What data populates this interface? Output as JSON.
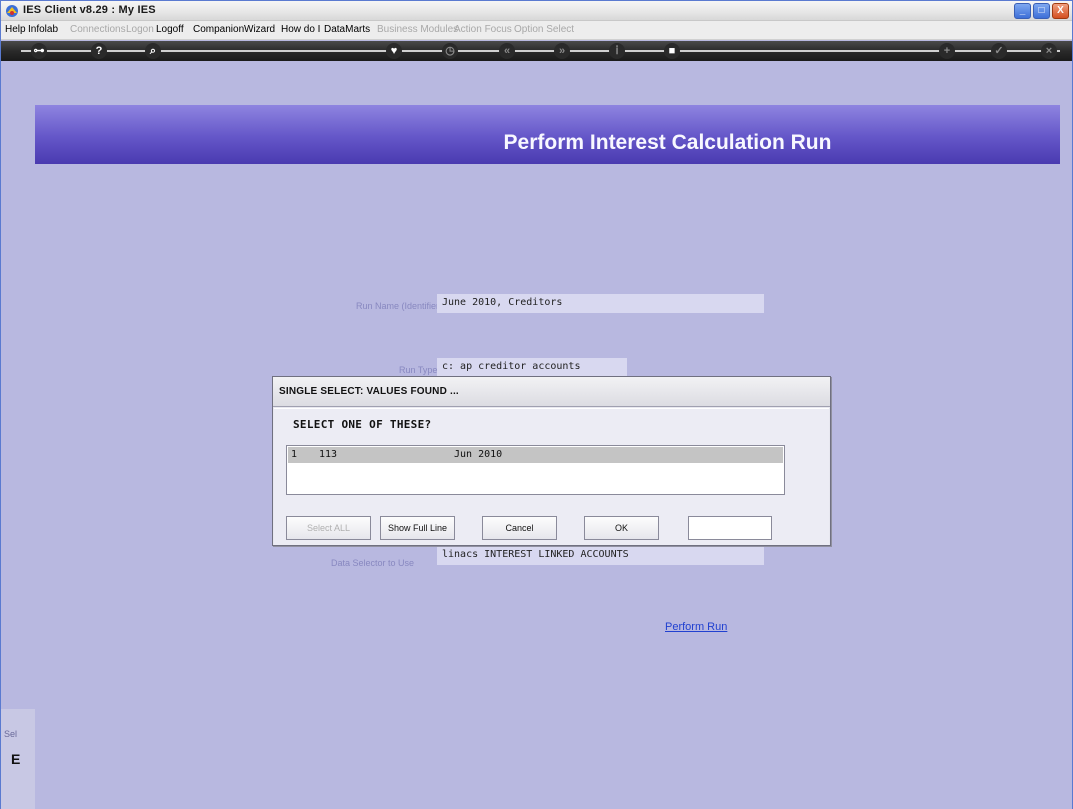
{
  "window": {
    "title": "IES Client v8.29 : My IES",
    "controls": {
      "minimize": "_",
      "maximize": "□",
      "close": "X"
    }
  },
  "menu": {
    "items": [
      {
        "label": "Help",
        "enabled": true
      },
      {
        "label": "Infolab",
        "enabled": true
      },
      {
        "label": "Connections",
        "enabled": false
      },
      {
        "label": "Logon",
        "enabled": false
      },
      {
        "label": "Logoff",
        "enabled": true
      },
      {
        "label": "Companion",
        "enabled": true
      },
      {
        "label": "Wizard",
        "enabled": true
      },
      {
        "label": "How do I",
        "enabled": true
      },
      {
        "label": "DataMarts",
        "enabled": true
      },
      {
        "label": "Business Modules",
        "enabled": false
      },
      {
        "label": "Action Focus",
        "enabled": false
      },
      {
        "label": "Option Select",
        "enabled": false
      }
    ]
  },
  "toolbar": {
    "icons": [
      {
        "name": "key-icon",
        "glyph": "⊶"
      },
      {
        "name": "help-icon",
        "glyph": "?"
      },
      {
        "name": "search-icon",
        "glyph": "⌕"
      },
      {
        "name": "heart-icon",
        "glyph": "♥"
      },
      {
        "name": "clock-icon",
        "glyph": "◷"
      },
      {
        "name": "back-icon",
        "glyph": "«"
      },
      {
        "name": "forward-icon",
        "glyph": "»"
      },
      {
        "name": "info-icon",
        "glyph": "ⅰ"
      },
      {
        "name": "stop-icon",
        "glyph": "■"
      },
      {
        "name": "add-icon",
        "glyph": "+"
      },
      {
        "name": "check-icon",
        "glyph": "✓"
      },
      {
        "name": "close-circle-icon",
        "glyph": "×"
      }
    ]
  },
  "page": {
    "title": "Perform Interest Calculation Run",
    "fields": {
      "run_name": {
        "label": "Run Name (Identifier)",
        "value": "June 2010, Creditors"
      },
      "run_type": {
        "label": "Run Type",
        "value": "c: ap creditor accounts"
      },
      "data_selector": {
        "label": "Data Selector to Use",
        "value": "linacs INTEREST LINKED ACCOUNTS"
      }
    },
    "perform_run_link": "Perform Run",
    "side_text": "Sel",
    "side_glyph": "E"
  },
  "dialog": {
    "title": "SINGLE SELECT: VALUES FOUND ...",
    "prompt": "SELECT ONE OF THESE?",
    "rows": [
      {
        "index": "1",
        "code": "113",
        "description": "Jun 2010"
      }
    ],
    "buttons": {
      "select_all": "Select ALL",
      "show_full_line": "Show Full Line",
      "cancel": "Cancel",
      "ok": "OK"
    },
    "input_value": ""
  },
  "colors": {
    "content_bg": "#b8b8e0",
    "banner": "#6456c8",
    "link": "#2040d0"
  }
}
